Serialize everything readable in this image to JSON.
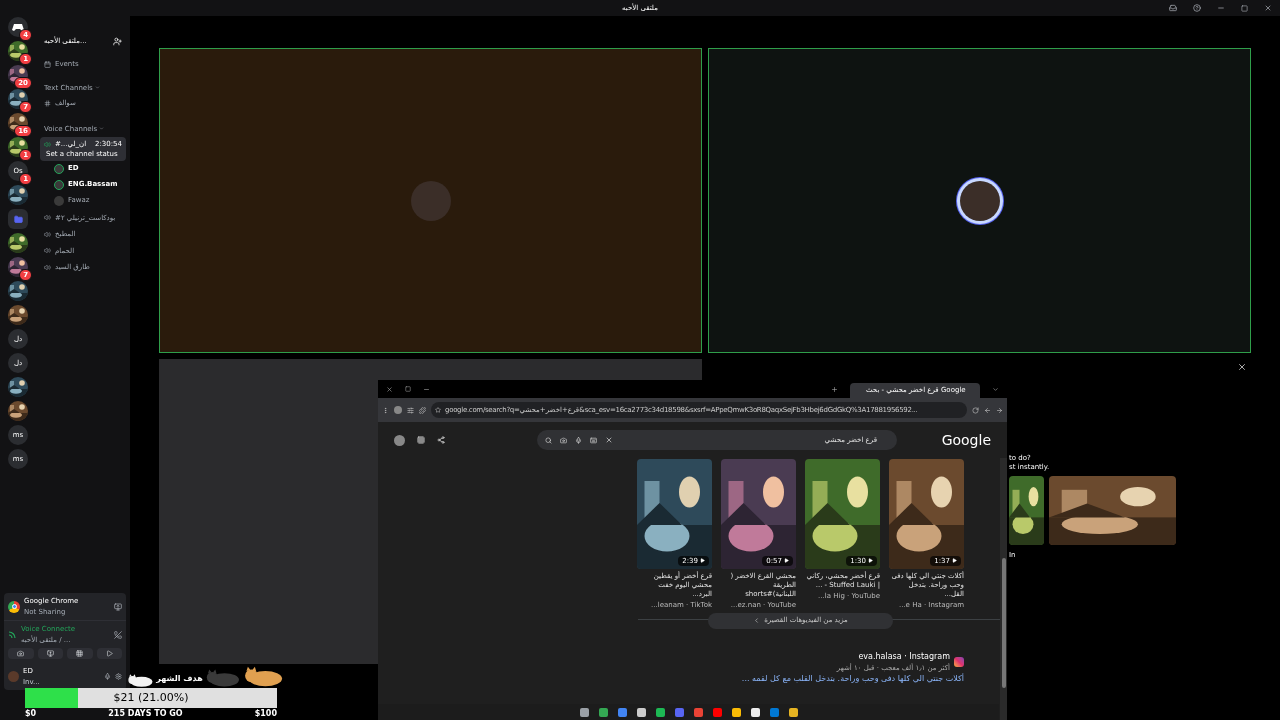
{
  "title_bar": {
    "title": "ملتقى الأحبه"
  },
  "servers": [
    {
      "kind": "home",
      "badge": "4"
    },
    {
      "kind": "picture",
      "badge": "1"
    },
    {
      "kind": "picture",
      "badge": "20"
    },
    {
      "kind": "picture",
      "badge": "7"
    },
    {
      "kind": "picture",
      "badge": "16"
    },
    {
      "kind": "picture",
      "badge": "1"
    },
    {
      "kind": "text",
      "label": "Os",
      "badge": "1"
    },
    {
      "kind": "picture"
    },
    {
      "kind": "folder"
    },
    {
      "kind": "picture"
    },
    {
      "kind": "picture",
      "badge": "7"
    },
    {
      "kind": "picture"
    },
    {
      "kind": "picture"
    },
    {
      "kind": "text",
      "label": "دل"
    },
    {
      "kind": "text",
      "label": "دل"
    },
    {
      "kind": "picture"
    },
    {
      "kind": "picture"
    },
    {
      "kind": "text",
      "label": "ms"
    },
    {
      "kind": "text",
      "label": "ms"
    }
  ],
  "sidebar": {
    "server_name": "ملتقى الأحبه...",
    "events": "Events",
    "categories": [
      {
        "name": "Text Channels",
        "channels": [
          {
            "kind": "text",
            "name": "سوالف",
            "selected": false
          }
        ]
      },
      {
        "name": "Voice Channels",
        "channels": [
          {
            "kind": "voice",
            "name": "#...ان_لي",
            "selected": true,
            "timer": "2:30:54",
            "status": "Set a channel status",
            "members": [
              {
                "name": "ED",
                "speaking": true
              },
              {
                "name": "ENG.Bassam",
                "speaking": true
              },
              {
                "name": "Fawaz",
                "speaking": false
              }
            ]
          },
          {
            "kind": "voice",
            "name": "#بودكاست_ترنيلي ٢",
            "selected": false
          },
          {
            "kind": "voice",
            "name": "المطبخ",
            "selected": false
          },
          {
            "kind": "voice",
            "name": "الحمام",
            "selected": false
          },
          {
            "kind": "voice",
            "name": "طارق السيد",
            "selected": false
          }
        ]
      }
    ]
  },
  "activity": {
    "app": "Google Chrome",
    "status": "Not Sharing"
  },
  "voice_panel": {
    "state": "Voice Connecte",
    "place": "ملتقى الأحبه / ..."
  },
  "user_panel": {
    "name": "ED",
    "status": "Inv..."
  },
  "tiles": [
    {
      "kind": "user",
      "color": "#2a1b0c",
      "speaking": false
    },
    {
      "kind": "user",
      "color": "#0e1311",
      "speaking": true
    },
    {
      "kind": "empty",
      "color": "#2b2b2d"
    }
  ],
  "browser": {
    "tab_title": "قرع اخضر محشي - بحث Google",
    "url": "google.com/search?q=قرع+اخضر+محشي&sca_esv=16ca2773c34d18598&sxsrf=APpeQmwK3oR8QaqxSejFb3Hbej6dGdGkQ%3A17881956592...",
    "logo": "Google",
    "query": "قرع اخضر محشي",
    "videos": [
      {
        "duration": "1:37",
        "title": "أكلات جنتي الي كلها دفى وحب وراحة. بتدخل القل...",
        "source": "...e Ha · Instagram"
      },
      {
        "duration": "1:30",
        "title": "قرع أخضر محشي، ركاني | Stuffed Lauki - ...",
        "source": "...la Hig · YouTube"
      },
      {
        "duration": "0:57",
        "title": "محشي القرع الاخضر ( الطريقة اللبنانية)#shorts",
        "source": "...ez.nan · YouTube"
      },
      {
        "duration": "2:39",
        "title": "قرع أخضر أو يقطين محشي اليوم خفت البرد...",
        "source": "...leanam · TikTok"
      }
    ],
    "more": "مزيد من الفيديوهات القصيرة",
    "result": {
      "source": "eva.halasa · Instagram",
      "meta": "أكثر من ١٫١ ألف معجب · قبل ١٠ أشهر",
      "link": "أكلات جنتي الي كلها دفى وحب وراحة. بتدخل القلب مع كل لقمه ..."
    }
  },
  "promo": {
    "line_1": "to do?",
    "line_2": "st instantly.",
    "line_3": "In"
  },
  "goal": {
    "label": "هدف الشهر",
    "level": 0.21,
    "reading": "$21 (21.00%)",
    "start": "$0",
    "days": "215 DAYS TO GO",
    "target": "$100"
  }
}
